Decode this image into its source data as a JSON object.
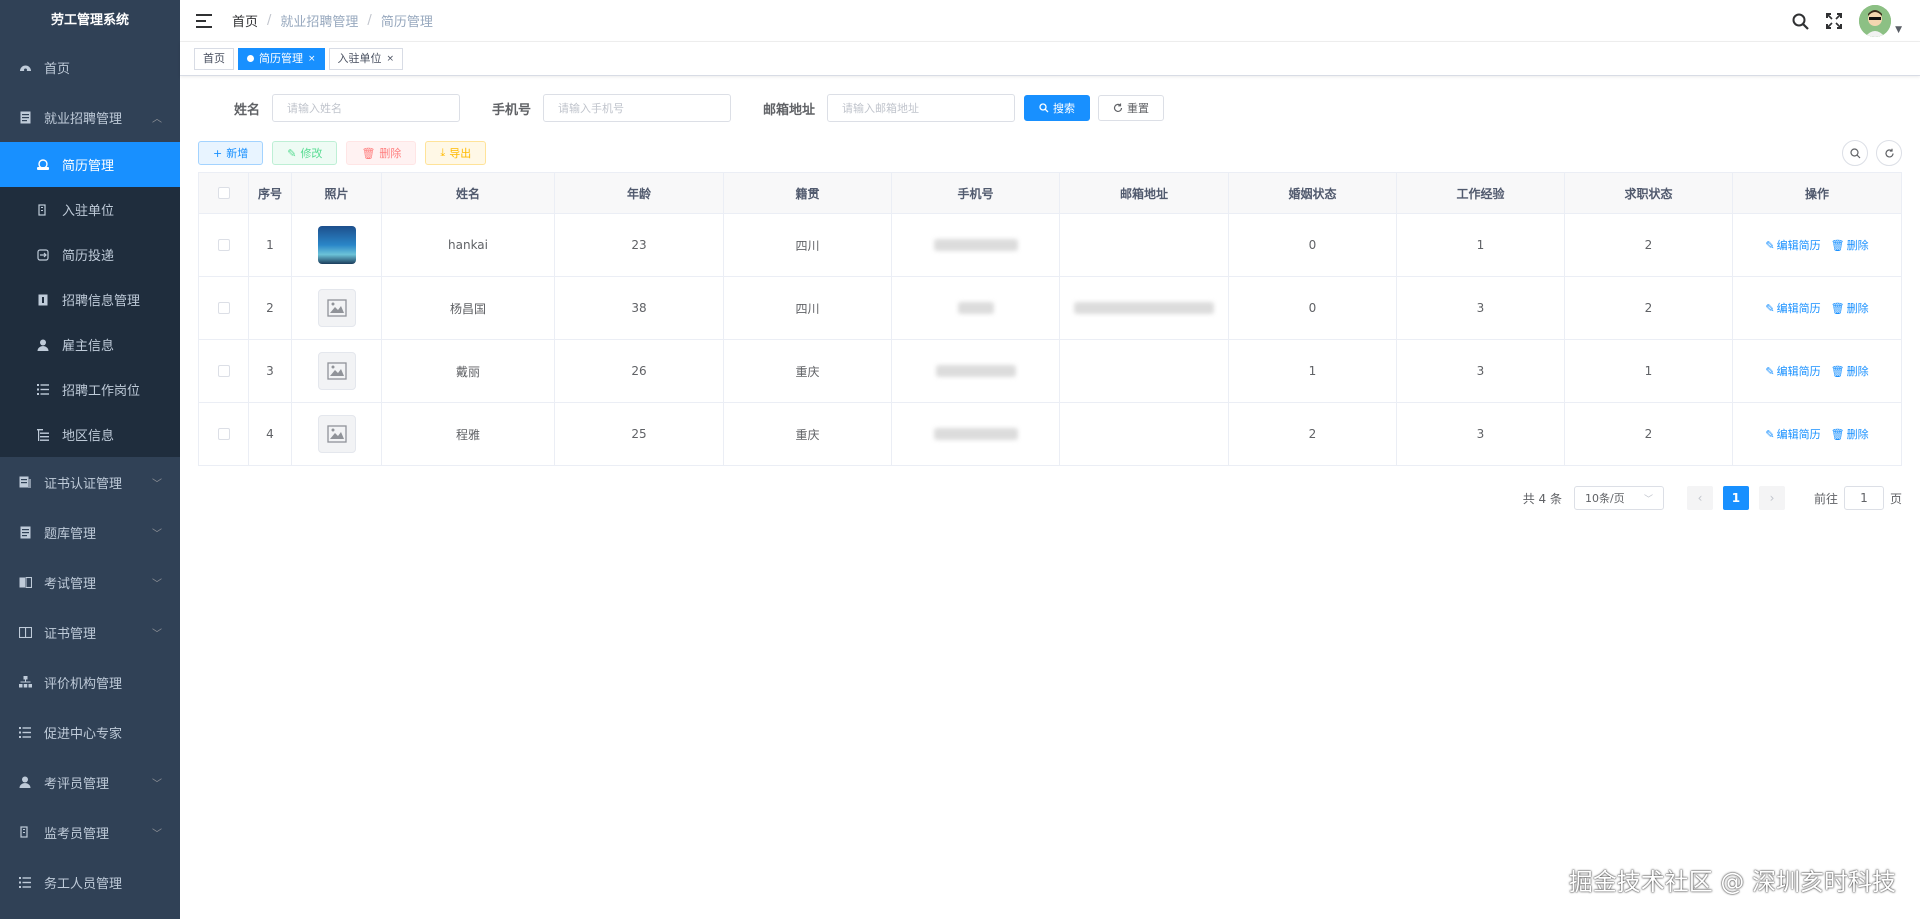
{
  "app": {
    "title": "劳工管理系统"
  },
  "sidebar": {
    "items": [
      {
        "label": "首页",
        "icon": "dashboard-icon"
      },
      {
        "label": "就业招聘管理",
        "icon": "document-icon",
        "expanded": true,
        "children": [
          {
            "label": "简历管理",
            "icon": "resume-icon",
            "active": true
          },
          {
            "label": "入驻单位",
            "icon": "building-icon"
          },
          {
            "label": "简历投递",
            "icon": "send-icon"
          },
          {
            "label": "招聘信息管理",
            "icon": "info-icon"
          },
          {
            "label": "雇主信息",
            "icon": "user-icon"
          },
          {
            "label": "招聘工作岗位",
            "icon": "list-icon"
          },
          {
            "label": "地区信息",
            "icon": "tree-icon"
          }
        ]
      },
      {
        "label": "证书认证管理",
        "icon": "certificate-icon"
      },
      {
        "label": "题库管理",
        "icon": "question-bank-icon"
      },
      {
        "label": "考试管理",
        "icon": "exam-icon"
      },
      {
        "label": "证书管理",
        "icon": "book-icon"
      },
      {
        "label": "评价机构管理",
        "icon": "org-icon"
      },
      {
        "label": "促进中心专家",
        "icon": "list-icon"
      },
      {
        "label": "考评员管理",
        "icon": "person-icon"
      },
      {
        "label": "监考员管理",
        "icon": "monitor-icon"
      },
      {
        "label": "务工人员管理",
        "icon": "list-icon"
      }
    ]
  },
  "breadcrumb": [
    "首页",
    "就业招聘管理",
    "简历管理"
  ],
  "tags": [
    {
      "label": "首页",
      "active": false
    },
    {
      "label": "简历管理",
      "active": true
    },
    {
      "label": "入驻单位",
      "active": false
    }
  ],
  "search": {
    "name_label": "姓名",
    "name_placeholder": "请输入姓名",
    "phone_label": "手机号",
    "phone_placeholder": "请输入手机号",
    "email_label": "邮箱地址",
    "email_placeholder": "请输入邮箱地址",
    "search_btn": "搜索",
    "reset_btn": "重置"
  },
  "toolbar": {
    "add": "新增",
    "edit": "修改",
    "delete": "删除",
    "export": "导出"
  },
  "table": {
    "columns": [
      "序号",
      "照片",
      "姓名",
      "年龄",
      "籍贯",
      "手机号",
      "邮箱地址",
      "婚姻状态",
      "工作经验",
      "求职状态",
      "操作"
    ],
    "rows": [
      {
        "idx": "1",
        "photo": "real",
        "name": "hankai",
        "age": "23",
        "place": "四川",
        "marriage": "0",
        "experience": "1",
        "status": "2"
      },
      {
        "idx": "2",
        "photo": "placeholder",
        "name": "杨昌国",
        "age": "38",
        "place": "四川",
        "marriage": "0",
        "experience": "3",
        "status": "2"
      },
      {
        "idx": "3",
        "photo": "placeholder",
        "name": "戴丽",
        "age": "26",
        "place": "重庆",
        "marriage": "1",
        "experience": "3",
        "status": "1"
      },
      {
        "idx": "4",
        "photo": "placeholder",
        "name": "程雅",
        "age": "25",
        "place": "重庆",
        "marriage": "2",
        "experience": "3",
        "status": "2"
      }
    ],
    "edit_link": "编辑简历",
    "delete_link": "删除"
  },
  "pagination": {
    "total": "共 4 条",
    "page_size": "10条/页",
    "current": "1",
    "goto_label": "前往",
    "goto_value": "1",
    "page_suffix": "页"
  },
  "watermark": "掘金技术社区 @ 深圳亥时科技",
  "colors": {
    "sidebar_bg": "#304156",
    "submenu_bg": "#1f2d3d",
    "primary": "#1890ff"
  }
}
